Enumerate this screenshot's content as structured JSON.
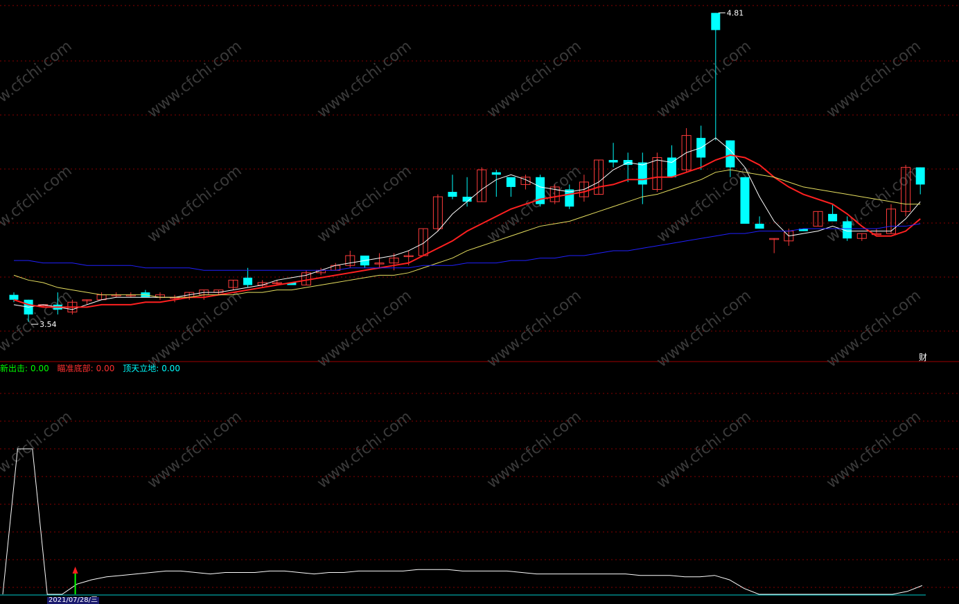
{
  "colors": {
    "up": "#ff3b3b",
    "down": "#00ffff",
    "ma_white": "#ffffff",
    "ma_red": "#ff2020",
    "ma_yellow": "#e8e060",
    "ma_blue": "#2020ff",
    "grid": "#8a0000",
    "watermark": "#3a3a3a"
  },
  "watermark": "www.cfchi.com",
  "indicator": {
    "items": [
      {
        "label": "新出击:",
        "value": "0.00",
        "color": "#00ff00"
      },
      {
        "label": "瞄准底部:",
        "value": "0.00",
        "color": "#ff3030"
      },
      {
        "label": "顶天立地:",
        "value": "0.00",
        "color": "#00ffff"
      }
    ]
  },
  "date_label": "2021/07/28/三",
  "cai_label": "财",
  "chart_data": [
    {
      "type": "candlestick",
      "title": "",
      "xlabel": "",
      "ylabel": "",
      "ylim": [
        3.45,
        4.84
      ],
      "annotations": [
        {
          "text": "3.54",
          "at_bar": 1,
          "value": 3.54
        },
        {
          "text": "4.81",
          "at_bar": 48,
          "value": 4.81
        }
      ],
      "candles": [
        {
          "o": 3.66,
          "h": 3.67,
          "l": 3.63,
          "c": 3.64
        },
        {
          "o": 3.64,
          "h": 3.64,
          "l": 3.55,
          "c": 3.58
        },
        {
          "o": 3.62,
          "h": 3.62,
          "l": 3.61,
          "c": 3.62
        },
        {
          "o": 3.62,
          "h": 3.67,
          "l": 3.58,
          "c": 3.6
        },
        {
          "o": 3.59,
          "h": 3.64,
          "l": 3.58,
          "c": 3.63
        },
        {
          "o": 3.64,
          "h": 3.64,
          "l": 3.62,
          "c": 3.64
        },
        {
          "o": 3.64,
          "h": 3.67,
          "l": 3.64,
          "c": 3.66
        },
        {
          "o": 3.66,
          "h": 3.67,
          "l": 3.65,
          "c": 3.66
        },
        {
          "o": 3.66,
          "h": 3.67,
          "l": 3.65,
          "c": 3.66
        },
        {
          "o": 3.67,
          "h": 3.68,
          "l": 3.65,
          "c": 3.65
        },
        {
          "o": 3.65,
          "h": 3.67,
          "l": 3.64,
          "c": 3.66
        },
        {
          "o": 3.65,
          "h": 3.66,
          "l": 3.63,
          "c": 3.65
        },
        {
          "o": 3.65,
          "h": 3.67,
          "l": 3.64,
          "c": 3.67
        },
        {
          "o": 3.66,
          "h": 3.68,
          "l": 3.64,
          "c": 3.68
        },
        {
          "o": 3.67,
          "h": 3.68,
          "l": 3.66,
          "c": 3.68
        },
        {
          "o": 3.69,
          "h": 3.72,
          "l": 3.68,
          "c": 3.72
        },
        {
          "o": 3.73,
          "h": 3.77,
          "l": 3.69,
          "c": 3.7
        },
        {
          "o": 3.7,
          "h": 3.72,
          "l": 3.69,
          "c": 3.71
        },
        {
          "o": 3.71,
          "h": 3.72,
          "l": 3.7,
          "c": 3.71
        },
        {
          "o": 3.71,
          "h": 3.71,
          "l": 3.7,
          "c": 3.7
        },
        {
          "o": 3.7,
          "h": 3.76,
          "l": 3.7,
          "c": 3.75
        },
        {
          "o": 3.75,
          "h": 3.77,
          "l": 3.74,
          "c": 3.76
        },
        {
          "o": 3.76,
          "h": 3.79,
          "l": 3.76,
          "c": 3.78
        },
        {
          "o": 3.78,
          "h": 3.84,
          "l": 3.77,
          "c": 3.82
        },
        {
          "o": 3.82,
          "h": 3.82,
          "l": 3.77,
          "c": 3.78
        },
        {
          "o": 3.79,
          "h": 3.83,
          "l": 3.77,
          "c": 3.79
        },
        {
          "o": 3.79,
          "h": 3.83,
          "l": 3.76,
          "c": 3.81
        },
        {
          "o": 3.82,
          "h": 3.84,
          "l": 3.78,
          "c": 3.82
        },
        {
          "o": 3.82,
          "h": 3.93,
          "l": 3.82,
          "c": 3.93
        },
        {
          "o": 3.93,
          "h": 4.07,
          "l": 3.92,
          "c": 4.06
        },
        {
          "o": 4.08,
          "h": 4.15,
          "l": 4.05,
          "c": 4.06
        },
        {
          "o": 4.06,
          "h": 4.14,
          "l": 4.02,
          "c": 4.04
        },
        {
          "o": 4.04,
          "h": 4.18,
          "l": 4.04,
          "c": 4.17
        },
        {
          "o": 4.16,
          "h": 4.17,
          "l": 4.06,
          "c": 4.15
        },
        {
          "o": 4.14,
          "h": 4.14,
          "l": 4.06,
          "c": 4.1
        },
        {
          "o": 4.11,
          "h": 4.15,
          "l": 4.09,
          "c": 4.14
        },
        {
          "o": 4.14,
          "h": 4.15,
          "l": 4.02,
          "c": 4.03
        },
        {
          "o": 4.04,
          "h": 4.11,
          "l": 4.03,
          "c": 4.1
        },
        {
          "o": 4.09,
          "h": 4.11,
          "l": 4.01,
          "c": 4.02
        },
        {
          "o": 4.06,
          "h": 4.15,
          "l": 4.04,
          "c": 4.12
        },
        {
          "o": 4.07,
          "h": 4.21,
          "l": 4.07,
          "c": 4.21
        },
        {
          "o": 4.21,
          "h": 4.28,
          "l": 4.18,
          "c": 4.2
        },
        {
          "o": 4.21,
          "h": 4.24,
          "l": 4.12,
          "c": 4.19
        },
        {
          "o": 4.2,
          "h": 4.24,
          "l": 4.03,
          "c": 4.11
        },
        {
          "o": 4.09,
          "h": 4.24,
          "l": 4.08,
          "c": 4.22
        },
        {
          "o": 4.22,
          "h": 4.27,
          "l": 4.17,
          "c": 4.14
        },
        {
          "o": 4.17,
          "h": 4.34,
          "l": 4.16,
          "c": 4.31
        },
        {
          "o": 4.3,
          "h": 4.35,
          "l": 4.17,
          "c": 4.22
        },
        {
          "o": 4.81,
          "h": 4.81,
          "l": 4.29,
          "c": 4.74
        },
        {
          "o": 4.29,
          "h": 4.29,
          "l": 4.14,
          "c": 4.18
        },
        {
          "o": 4.14,
          "h": 4.13,
          "l": 3.95,
          "c": 3.95
        },
        {
          "o": 3.95,
          "h": 3.98,
          "l": 3.93,
          "c": 3.93
        },
        {
          "o": 3.89,
          "h": 3.89,
          "l": 3.83,
          "c": 3.89
        },
        {
          "o": 3.88,
          "h": 3.93,
          "l": 3.86,
          "c": 3.92
        },
        {
          "o": 3.93,
          "h": 3.91,
          "l": 3.92,
          "c": 3.92
        },
        {
          "o": 3.94,
          "h": 4.0,
          "l": 3.94,
          "c": 4.0
        },
        {
          "o": 3.99,
          "h": 4.03,
          "l": 3.96,
          "c": 3.96
        },
        {
          "o": 3.96,
          "h": 3.98,
          "l": 3.88,
          "c": 3.89
        },
        {
          "o": 3.89,
          "h": 3.91,
          "l": 3.88,
          "c": 3.91
        },
        {
          "o": 3.91,
          "h": 3.93,
          "l": 3.91,
          "c": 3.91
        },
        {
          "o": 3.91,
          "h": 4.03,
          "l": 3.91,
          "c": 4.01
        },
        {
          "o": 4.0,
          "h": 4.19,
          "l": 3.98,
          "c": 4.18
        },
        {
          "o": 4.18,
          "h": 4.18,
          "l": 4.07,
          "c": 4.11
        }
      ],
      "series": [
        {
          "name": "",
          "color": "#ffffff",
          "values": [
            3.62,
            3.61,
            3.62,
            3.61,
            3.6,
            3.62,
            3.64,
            3.65,
            3.65,
            3.65,
            3.65,
            3.65,
            3.66,
            3.67,
            3.67,
            3.68,
            3.69,
            3.7,
            3.72,
            3.73,
            3.74,
            3.76,
            3.78,
            3.79,
            3.8,
            3.81,
            3.82,
            3.84,
            3.87,
            3.92,
            3.99,
            4.04,
            4.09,
            4.13,
            4.15,
            4.13,
            4.1,
            4.09,
            4.08,
            4.09,
            4.12,
            4.17,
            4.2,
            4.19,
            4.21,
            4.2,
            4.24,
            4.26,
            4.3,
            4.25,
            4.18,
            4.06,
            3.96,
            3.9,
            3.91,
            3.92,
            3.94,
            3.92,
            3.92,
            3.92,
            3.92,
            3.97,
            4.04
          ]
        },
        {
          "name": "",
          "color": "#ff2020",
          "values": [
            3.64,
            3.62,
            3.61,
            3.61,
            3.61,
            3.61,
            3.62,
            3.62,
            3.62,
            3.63,
            3.63,
            3.64,
            3.65,
            3.65,
            3.66,
            3.67,
            3.68,
            3.69,
            3.7,
            3.71,
            3.72,
            3.73,
            3.74,
            3.75,
            3.76,
            3.77,
            3.78,
            3.79,
            3.82,
            3.85,
            3.88,
            3.92,
            3.95,
            3.98,
            4.01,
            4.03,
            4.05,
            4.06,
            4.07,
            4.08,
            4.1,
            4.11,
            4.13,
            4.13,
            4.14,
            4.14,
            4.16,
            4.18,
            4.21,
            4.23,
            4.22,
            4.19,
            4.14,
            4.1,
            4.07,
            4.05,
            4.03,
            3.99,
            3.94,
            3.9,
            3.9,
            3.92,
            3.97
          ]
        },
        {
          "name": "",
          "color": "#e8e060",
          "values": [
            3.74,
            3.72,
            3.71,
            3.69,
            3.68,
            3.67,
            3.66,
            3.66,
            3.66,
            3.66,
            3.65,
            3.65,
            3.65,
            3.66,
            3.66,
            3.66,
            3.67,
            3.67,
            3.68,
            3.68,
            3.69,
            3.7,
            3.71,
            3.72,
            3.73,
            3.74,
            3.74,
            3.75,
            3.77,
            3.79,
            3.81,
            3.84,
            3.86,
            3.88,
            3.9,
            3.92,
            3.94,
            3.95,
            3.96,
            3.98,
            4.0,
            4.02,
            4.04,
            4.06,
            4.07,
            4.09,
            4.11,
            4.13,
            4.16,
            4.17,
            4.16,
            4.15,
            4.14,
            4.12,
            4.1,
            4.09,
            4.08,
            4.07,
            4.06,
            4.05,
            4.04,
            4.03,
            4.03
          ]
        },
        {
          "name": "",
          "color": "#2020ff",
          "values": [
            3.8,
            3.8,
            3.79,
            3.79,
            3.79,
            3.78,
            3.78,
            3.78,
            3.78,
            3.77,
            3.77,
            3.77,
            3.77,
            3.76,
            3.76,
            3.76,
            3.76,
            3.76,
            3.76,
            3.76,
            3.76,
            3.76,
            3.76,
            3.77,
            3.77,
            3.77,
            3.77,
            3.77,
            3.78,
            3.78,
            3.78,
            3.79,
            3.79,
            3.79,
            3.8,
            3.8,
            3.81,
            3.81,
            3.82,
            3.82,
            3.83,
            3.84,
            3.84,
            3.85,
            3.86,
            3.87,
            3.88,
            3.89,
            3.9,
            3.91,
            3.91,
            3.92,
            3.92,
            3.92,
            3.93,
            3.93,
            3.93,
            3.93,
            3.93,
            3.93,
            3.94,
            3.94,
            3.95
          ]
        }
      ]
    },
    {
      "type": "line",
      "title": "",
      "xlabel": "",
      "ylabel": "",
      "ylim": [
        0,
        100
      ],
      "series": [
        {
          "name": "",
          "color": "#ffffff",
          "values": [
            0,
            100,
            100,
            0,
            0,
            7,
            10,
            12,
            13,
            14,
            15,
            16,
            16,
            15,
            14,
            15,
            15,
            15,
            16,
            16,
            15,
            14,
            15,
            15,
            16,
            16,
            16,
            16,
            17,
            17,
            17,
            16,
            16,
            16,
            16,
            15,
            14,
            14,
            14,
            14,
            14,
            14,
            14,
            13,
            13,
            13,
            12,
            12,
            13,
            10,
            4,
            0,
            0,
            0,
            0,
            0,
            0,
            0,
            0,
            0,
            0,
            2,
            6
          ]
        }
      ],
      "markers": [
        {
          "at_point": 4,
          "type": "arrow-up",
          "color": "#ff2020",
          "stem_color": "#00ff00"
        }
      ]
    }
  ]
}
